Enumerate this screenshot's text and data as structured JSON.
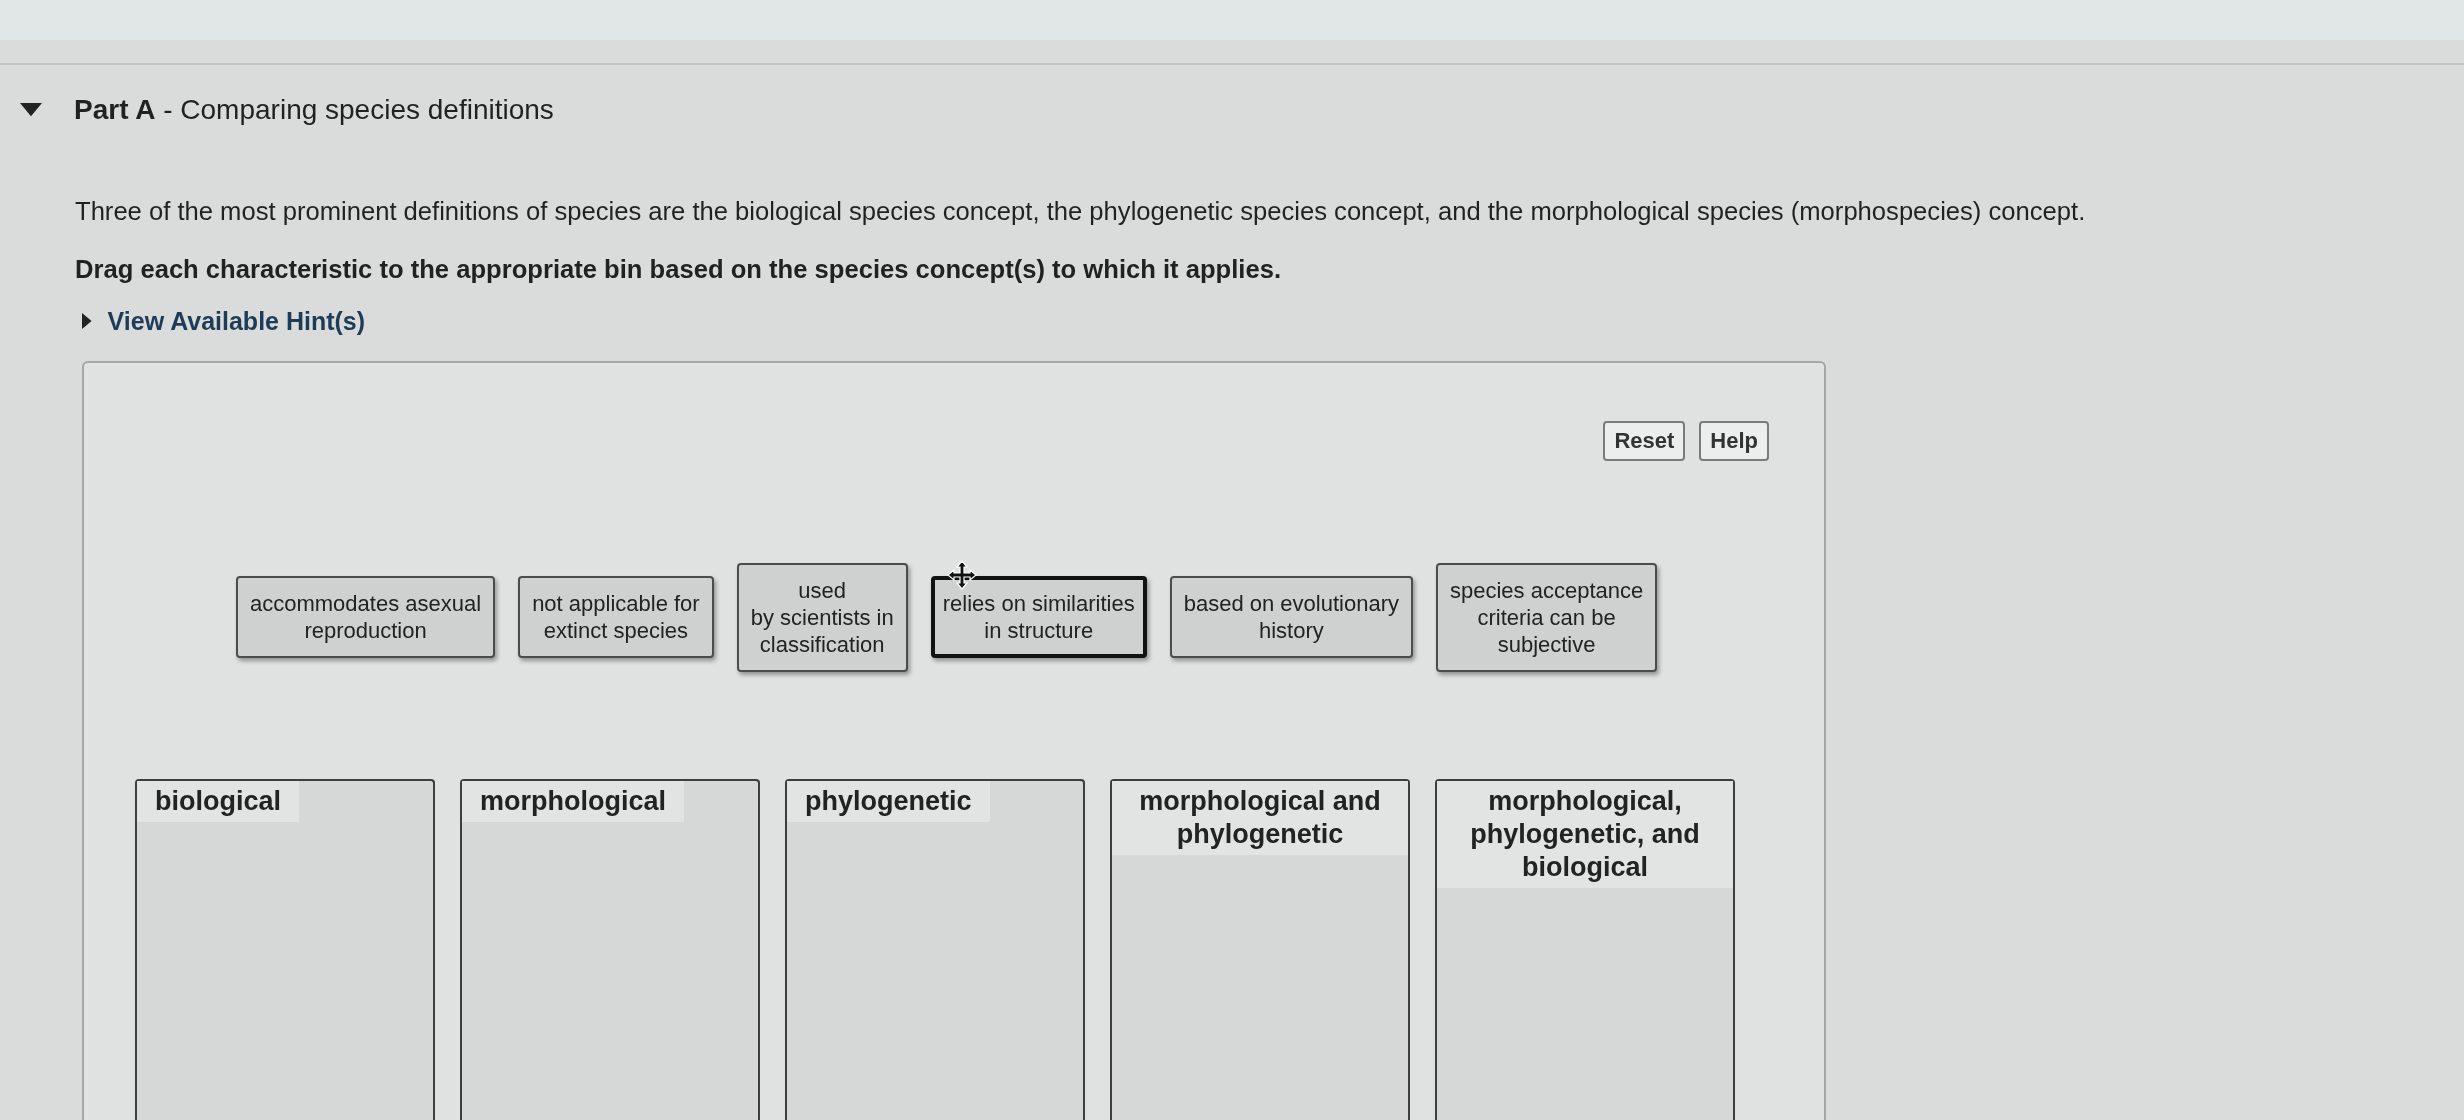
{
  "part": {
    "expanded": true,
    "title": "**Part A** - Comparing species definitions"
  },
  "intro": "Three of the most prominent definitions of species are the biological species concept, the phylogenetic species concept, and the morphological species (morphospecies) concept.",
  "instruction": "Drag each characteristic to the appropriate bin based on the species concept(s) to which it applies.",
  "hint": {
    "label": "View Available Hint(s)",
    "expanded": false
  },
  "toolbar": [
    {
      "label": "Reset"
    },
    {
      "label": "Help"
    }
  ],
  "items": [
    {
      "label": "accommodates asexual\nreproduction",
      "selected": false
    },
    {
      "label": "not applicable for\nextinct species",
      "selected": false
    },
    {
      "label": "used\nby scientists in\nclassification",
      "selected": false
    },
    {
      "label": "relies on similarities\nin structure",
      "selected": true
    },
    {
      "label": "based on evolutionary\nhistory",
      "selected": false
    },
    {
      "label": "species acceptance\ncriteria can be\nsubjective",
      "selected": false
    }
  ],
  "bins": [
    {
      "label": "biological"
    },
    {
      "label": "morphological"
    },
    {
      "label": "phylogenetic"
    },
    {
      "label": "morphological and phylogenetic"
    },
    {
      "label": "morphological, phylogenetic, and biological"
    }
  ]
}
